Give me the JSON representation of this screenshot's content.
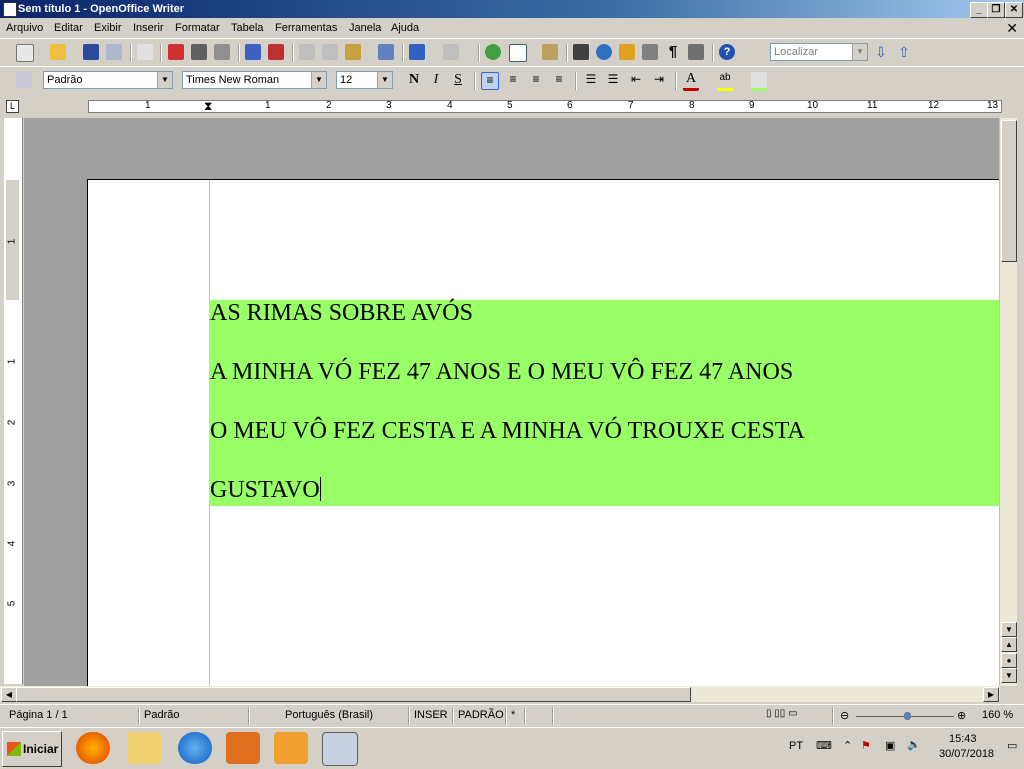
{
  "window": {
    "title": "Sem título 1 - OpenOffice Writer"
  },
  "menu": {
    "items": [
      "Arquivo",
      "Editar",
      "Exibir",
      "Inserir",
      "Formatar",
      "Tabela",
      "Ferramentas",
      "Janela",
      "Ajuda"
    ]
  },
  "toolbar": {
    "find_placeholder": "Localizar"
  },
  "format": {
    "style": "Padrão",
    "font": "Times New Roman",
    "size": "12",
    "bold": "N",
    "italic": "I",
    "underline": "S"
  },
  "ruler": {
    "h_numbers": [
      "1",
      "1",
      "2",
      "3",
      "4",
      "5",
      "6",
      "7",
      "8",
      "9",
      "10",
      "11",
      "12",
      "13"
    ],
    "v_numbers": [
      "1",
      "1",
      "2",
      "3",
      "4",
      "5"
    ]
  },
  "document": {
    "lines": [
      "AS RIMAS SOBRE AVÓS",
      "A MINHA VÓ FEZ 47 ANOS  E O MEU VÔ FEZ 47 ANOS",
      "O MEU VÔ FEZ CESTA  E A MINHA VÓ TROUXE CESTA",
      "GUSTAVO"
    ],
    "highlight_color": "#99ff66"
  },
  "status": {
    "page": "Página 1 / 1",
    "style": "Padrão",
    "language": "Português (Brasil)",
    "insert_mode": "INSER",
    "selection_mode": "PADRÃO",
    "modified": "*",
    "zoom": "160 %"
  },
  "taskbar": {
    "start": "Iniciar",
    "lang": "PT",
    "time": "15:43",
    "date": "30/07/2018"
  }
}
